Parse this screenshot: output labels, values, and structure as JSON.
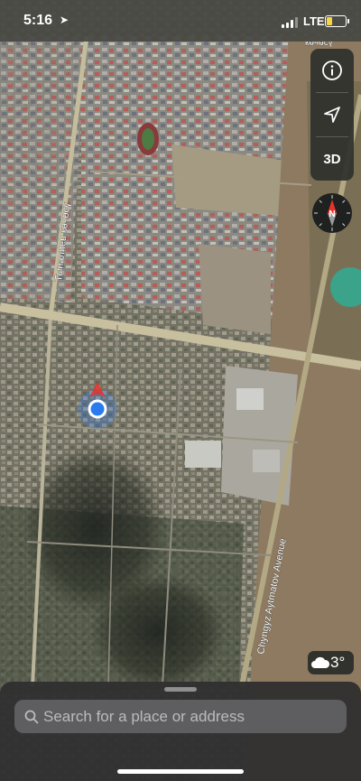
{
  "status_bar": {
    "time": "5:16",
    "carrier": "LTE",
    "battery_color": "#f7d34a"
  },
  "map": {
    "street_labels": [
      "Тыналиев көчөсү",
      "Chyngyz Aytmatov Avenue",
      "көчөсү"
    ]
  },
  "controls": {
    "info_icon": "info-icon",
    "location_icon": "location-arrow-icon",
    "mode_3d_label": "3D",
    "compass_label": "N"
  },
  "weather": {
    "icon": "cloud-icon",
    "temperature": "3°"
  },
  "search": {
    "placeholder": "Search for a place or address"
  },
  "colors": {
    "user_location": "#2b7bf0",
    "compass_north": "#e8322b"
  }
}
